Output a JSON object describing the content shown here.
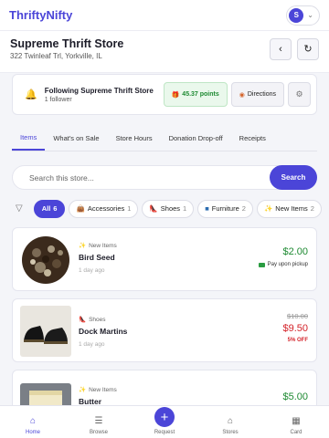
{
  "app": {
    "logo": "ThriftyNifty",
    "avatar_initial": "S"
  },
  "store": {
    "name": "Supreme Thrift Store",
    "address": "322 Twinleaf Trl, Yorkville, IL"
  },
  "follow": {
    "title": "Following Supreme Thrift Store",
    "followers": "1 follower",
    "points": "45.37 points",
    "directions": "Directions"
  },
  "tabs": [
    {
      "label": "Items",
      "active": true
    },
    {
      "label": "What's on Sale"
    },
    {
      "label": "Store Hours"
    },
    {
      "label": "Donation Drop-off"
    },
    {
      "label": "Receipts"
    }
  ],
  "search": {
    "placeholder": "Search this store...",
    "button": "Search"
  },
  "filters": [
    {
      "label": "All",
      "count": "6",
      "active": true
    },
    {
      "label": "Accessories",
      "count": "1",
      "icon": "handbag-icon"
    },
    {
      "label": "Shoes",
      "count": "1",
      "icon": "shoe-icon"
    },
    {
      "label": "Furniture",
      "count": "2",
      "icon": "furniture-icon"
    },
    {
      "label": "New Items",
      "count": "2",
      "icon": "sparkle-icon"
    }
  ],
  "items": [
    {
      "category": "New Items",
      "title": "Bird Seed",
      "ago": "1 day ago",
      "price": "$2.00",
      "note": "Pay upon pickup"
    },
    {
      "category": "Shoes",
      "title": "Dock Martins",
      "ago": "1 day ago",
      "old_price": "$10.00",
      "price": "$9.50",
      "discount": "5% OFF"
    },
    {
      "category": "New Items",
      "title": "Butter",
      "ago": "",
      "price": "$5.00"
    }
  ],
  "nav": [
    {
      "label": "Home",
      "active": true
    },
    {
      "label": "Browse"
    },
    {
      "label": "Request"
    },
    {
      "label": "Stores"
    },
    {
      "label": "Card"
    }
  ],
  "colors": {
    "accent": "#4b45d8",
    "price_green": "#1e8a32",
    "sale_red": "#d4232a"
  }
}
